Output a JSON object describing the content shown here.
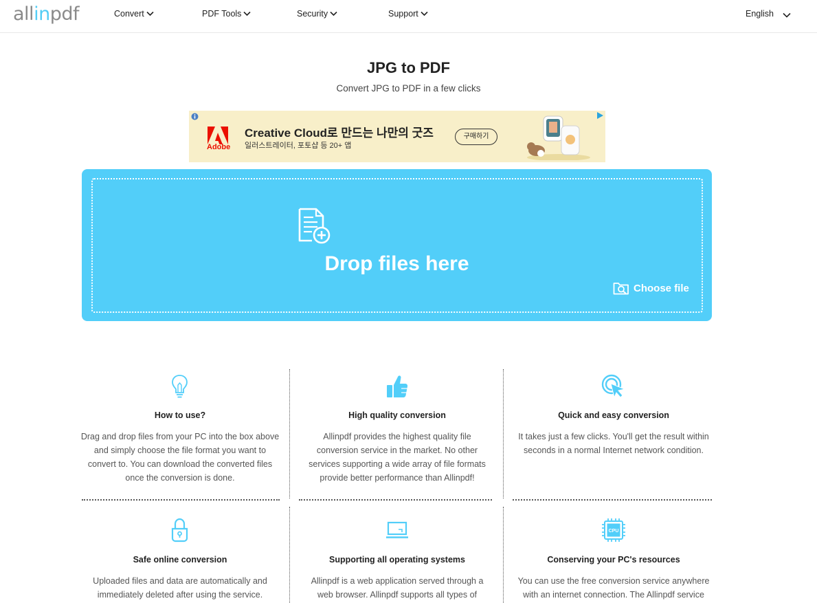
{
  "header": {
    "logo_prefix": "all",
    "logo_accent": "in",
    "logo_suffix": "pdf",
    "nav": [
      {
        "label": "Convert"
      },
      {
        "label": "PDF Tools"
      },
      {
        "label": "Security"
      },
      {
        "label": "Support"
      }
    ],
    "language": "English"
  },
  "page": {
    "title": "JPG to PDF",
    "subtitle": "Convert JPG to PDF in a few clicks"
  },
  "ad": {
    "brand": "Adobe",
    "headline": "Creative Cloud로 만드는 나만의 굿즈",
    "subline": "일러스트레이터, 포토샵 등 20+ 앱",
    "button": "구매하기"
  },
  "dropzone": {
    "label": "Drop files here",
    "choose_file": "Choose file",
    "icon": "document-add-icon"
  },
  "features": [
    {
      "icon": "lightbulb-icon",
      "title": "How to use?",
      "lines": [
        "Drag and drop files from your PC into the box above",
        "and simply choose the file format you want to",
        "convert to. You can download the converted files",
        "once the conversion is done."
      ]
    },
    {
      "icon": "thumbs-up-icon",
      "title": "High quality conversion",
      "lines": [
        "Allinpdf provides the highest quality file",
        "conversion service in the market. No other",
        "services supporting a wide array of file formats",
        "provide better performance than Allinpdf!"
      ]
    },
    {
      "icon": "cursor-click-icon",
      "title": "Quick and easy conversion",
      "lines": [
        "It takes just a few clicks. You'll get the result within",
        "seconds in a normal Internet network condition."
      ]
    },
    {
      "icon": "lock-icon",
      "title": "Safe online conversion",
      "lines": [
        "Uploaded files and data are automatically and",
        "immediately deleted after using the service."
      ]
    },
    {
      "icon": "laptop-icon",
      "title": "Supporting all operating systems",
      "lines": [
        "Allinpdf is a web application served through a",
        "web browser. Allinpdf supports all types of"
      ]
    },
    {
      "icon": "cpu-icon",
      "title": "Conserving your PC's resources",
      "cpu_label": "CPU",
      "lines": [
        "You can use the free conversion service anywhere",
        "with an internet connection. The Allinpdf service"
      ]
    }
  ],
  "colors": {
    "accent": "#52cef9",
    "logo_gray": "#8a8a8a",
    "ad_bg": "#f8efc9",
    "adobe_red": "#eb1000"
  }
}
